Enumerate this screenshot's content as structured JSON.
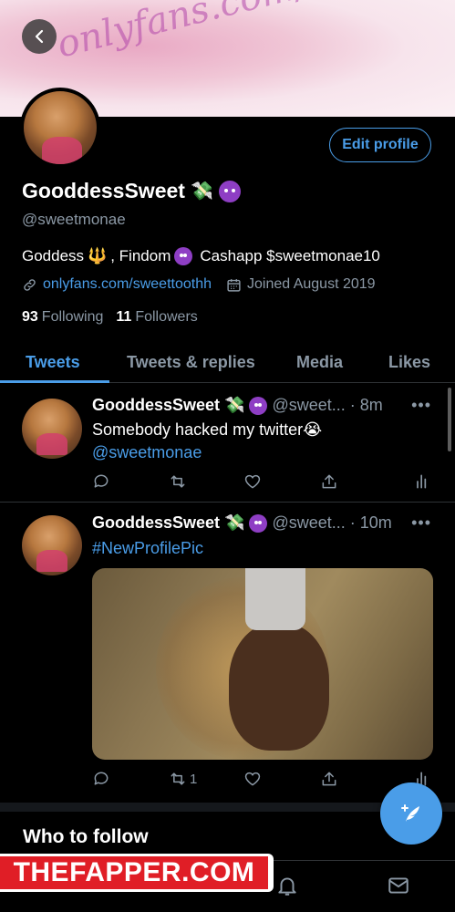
{
  "banner": {
    "text": "onlyfans.com/Sweettooth"
  },
  "profile": {
    "edit_label": "Edit profile",
    "name": "GooddessSweet",
    "name_emoji": "💸",
    "handle": "@sweetmonae",
    "bio_part1": "Goddess",
    "bio_trident": "🔱",
    "bio_part2": ", Findom",
    "bio_part3": "Cashapp $sweetmonae10",
    "link": "onlyfans.com/sweettoothh",
    "joined": "Joined August 2019",
    "following_count": "93",
    "following_label": "Following",
    "followers_count": "11",
    "followers_label": "Followers"
  },
  "tabs": [
    "Tweets",
    "Tweets & replies",
    "Media",
    "Likes"
  ],
  "tweets": [
    {
      "name": "GooddessSweet",
      "emoji": "💸",
      "handle": "@sweet...",
      "time": "· 8m",
      "text": "Somebody hacked my twitter",
      "text_emoji": "😭",
      "link": "@sweetmonae",
      "retweets": ""
    },
    {
      "name": "GooddessSweet",
      "emoji": "💸",
      "handle": "@sweet...",
      "time": "· 10m",
      "text": "#NewProfilePic",
      "retweets": "1"
    }
  ],
  "more_label": "•••",
  "who_to_follow": "Who to follow",
  "watermark": "THEFAPPER.COM",
  "colors": {
    "accent": "#4a9de8",
    "background": "#000000",
    "secondary_text": "#8b98a5"
  }
}
